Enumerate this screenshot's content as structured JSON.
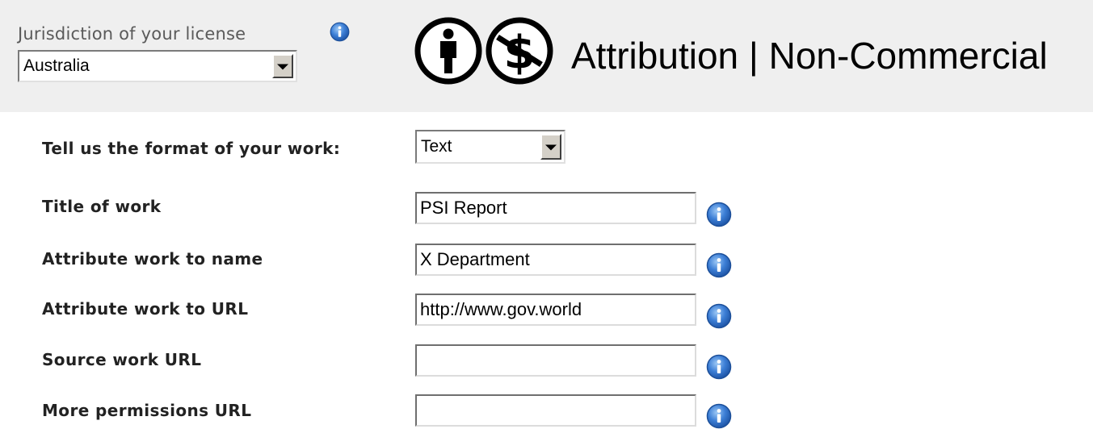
{
  "header": {
    "jurisdiction_label": "Jurisdiction of your license",
    "jurisdiction_value": "Australia",
    "license_title": "Attribution | Non-Commercial",
    "icons": [
      "attribution-icon",
      "non-commercial-icon",
      "info-icon"
    ]
  },
  "form": {
    "format_label": "Tell us the format of your work:",
    "format_value": "Text",
    "title_label": "Title of work",
    "title_value": "PSI Report",
    "attr_name_label": "Attribute work to name",
    "attr_name_value": "X Department",
    "attr_url_label": "Attribute work to URL",
    "attr_url_value": "http://www.gov.world",
    "source_url_label": "Source work URL",
    "source_url_value": "",
    "more_perm_label": "More permissions URL",
    "more_perm_value": ""
  },
  "colors": {
    "header_bg": "#efefef",
    "info_blue": "#2f6fc9"
  }
}
